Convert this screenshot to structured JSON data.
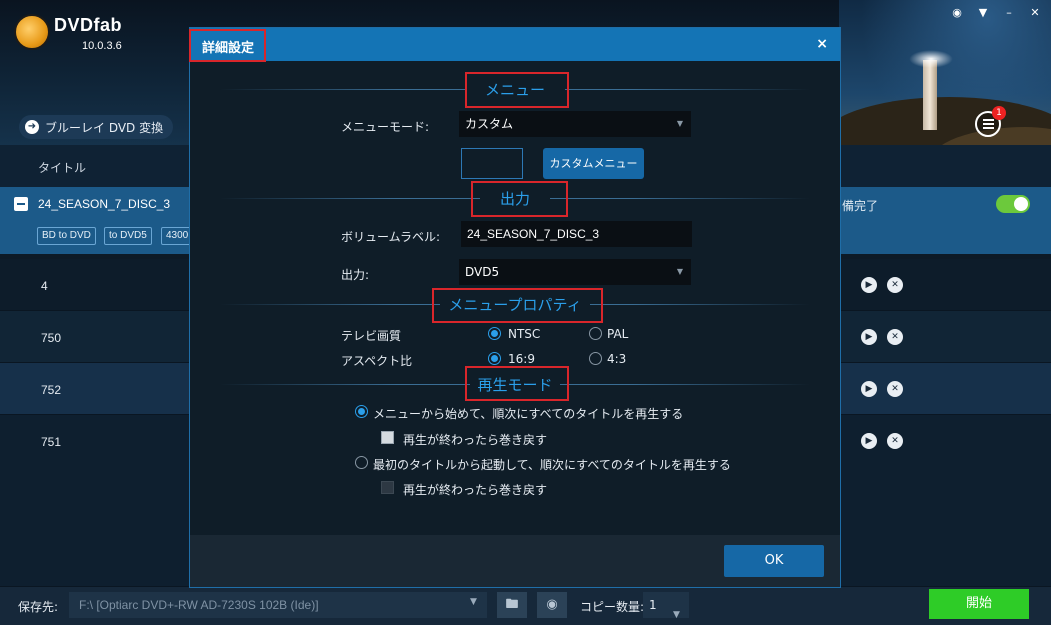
{
  "app": {
    "logo_text": "DVDfab",
    "version": "10.0.3.6",
    "window_controls": [
      "tshirt-icon",
      "wifi-icon",
      "minimize-icon",
      "close-icon"
    ]
  },
  "toolbar": {
    "convert_button": "ブルーレイ DVD 変換"
  },
  "list": {
    "header_label": "タイトル",
    "selected_item": {
      "name": "24_SEASON_7_DISC_3",
      "chips": [
        "BD to DVD",
        "to DVD5",
        "4300"
      ],
      "status": "備完了"
    },
    "titles": [
      "4",
      "750",
      "752",
      "751"
    ]
  },
  "queue": {
    "badge_count": "1"
  },
  "bottom_bar": {
    "save_label": "保存先:",
    "save_path": "F:\\ [Optiarc DVD+-RW AD-7230S 102B (Ide)]",
    "copies_label": "コピー数量:",
    "copies_value": "1",
    "start_button": "開始"
  },
  "dialog": {
    "title": "詳細設定",
    "close_glyph": "×",
    "sections": {
      "menu": "メニュー",
      "output": "出力",
      "menu_properties": "メニュープロパティ",
      "play_mode": "再生モード"
    },
    "menu_mode_label": "メニューモード:",
    "menu_mode_value": "カスタム",
    "custom_menu_button": "カスタムメニュー",
    "volume_label_label": "ボリュームラベル:",
    "volume_label_value": "24_SEASON_7_DISC_3",
    "output_label": "出力:",
    "output_value": "DVD5",
    "tv_format_label": "テレビ画質",
    "tv_format_options": [
      "NTSC",
      "PAL"
    ],
    "tv_format_selected": "NTSC",
    "aspect_label": "アスペクト比",
    "aspect_options": [
      "16:9",
      "4:3"
    ],
    "aspect_selected": "16:9",
    "play_option_1": "メニューから始めて、順次にすべてのタイトルを再生する",
    "play_option_1_sub": "再生が終わったら巻き戻す",
    "play_option_2": "最初のタイトルから起動して、順次にすべてのタイトルを再生する",
    "play_option_2_sub": "再生が終わったら巻き戻す",
    "play_selected": "option_1",
    "ok_button": "OK"
  },
  "colors": {
    "accent": "#1474b5",
    "section_title": "#2b9fea",
    "highlight_border": "#d9262b",
    "start_green": "#2ecc27"
  }
}
